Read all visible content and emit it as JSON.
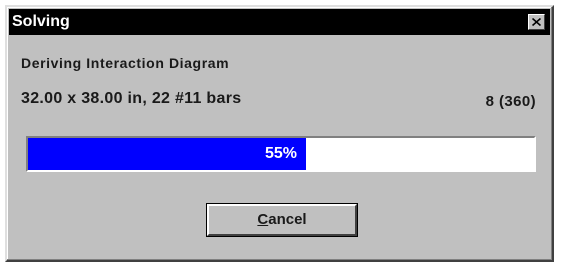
{
  "window": {
    "title": "Solving"
  },
  "status": {
    "task": "Deriving Interaction Diagram",
    "detail": "32.00 x 38.00 in, 22 #11 bars",
    "count": "8 (360)"
  },
  "progress": {
    "percent": 55,
    "label": "55%",
    "fill_color": "#0000ff",
    "track_color": "#ffffff"
  },
  "buttons": {
    "cancel_mnemonic": "C",
    "cancel_rest": "ancel"
  },
  "icons": {
    "close": "close-icon"
  },
  "colors": {
    "dialog_face": "#c0c0c0",
    "titlebar": "#000000"
  }
}
